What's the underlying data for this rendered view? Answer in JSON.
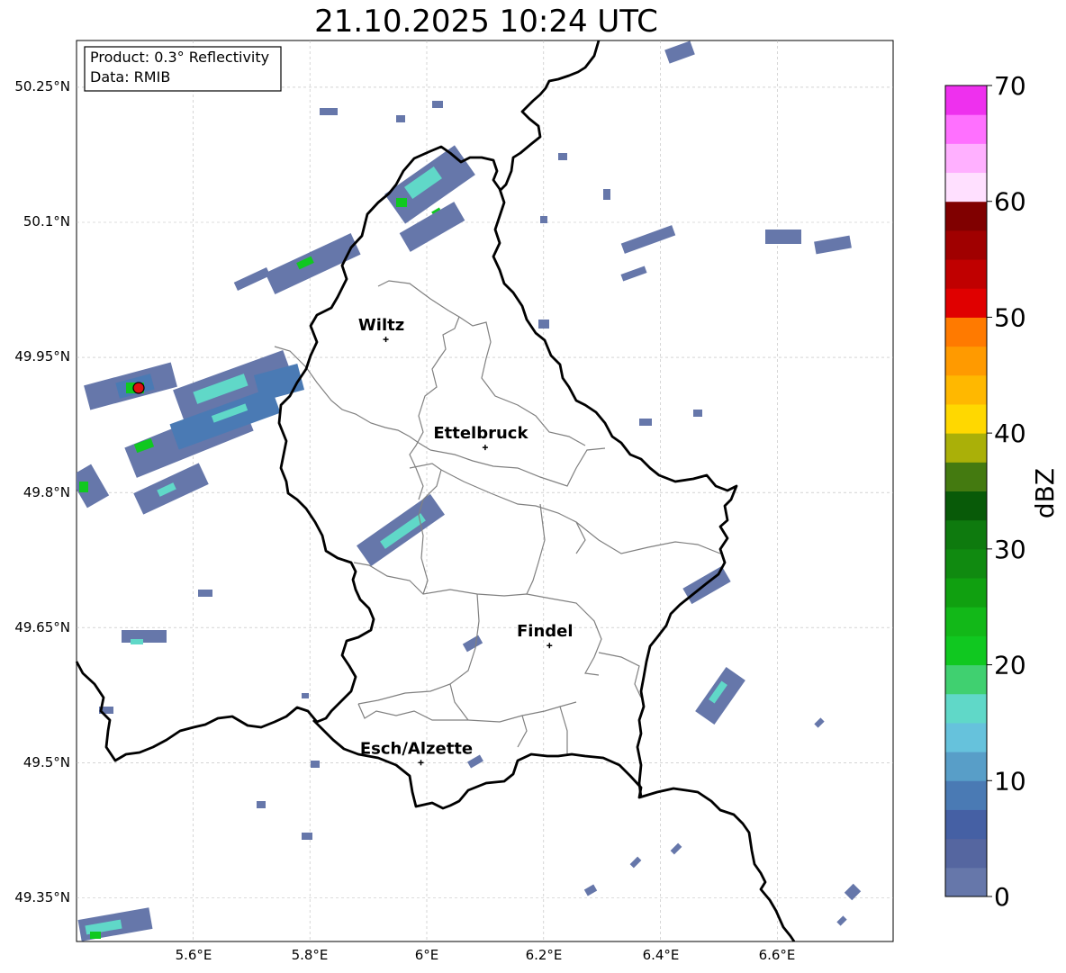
{
  "title": "21.10.2025 10:24 UTC",
  "info_box": {
    "product": "Product: 0.3° Reflectivity",
    "source": "Data: RMIB"
  },
  "lat_ticks": [
    "50.25°N",
    "50.1°N",
    "49.95°N",
    "49.8°N",
    "49.65°N",
    "49.5°N",
    "49.35°N"
  ],
  "lon_ticks": [
    "5.6°E",
    "5.8°E",
    "6°E",
    "6.2°E",
    "6.4°E",
    "6.6°E"
  ],
  "cities": [
    {
      "name": "Wiltz",
      "lat": 49.97,
      "lon": 5.93
    },
    {
      "name": "Ettelbruck",
      "lat": 49.85,
      "lon": 6.1
    },
    {
      "name": "Findel",
      "lat": 49.63,
      "lon": 6.21
    },
    {
      "name": "Esch/Alzette",
      "lat": 49.5,
      "lon": 5.99
    }
  ],
  "radar_site": {
    "lat": 49.915,
    "lon": 5.505
  },
  "colorbar": {
    "label": "dBZ",
    "ticks": [
      "0",
      "10",
      "20",
      "30",
      "40",
      "50",
      "60",
      "70"
    ],
    "colors": [
      "#6677aa",
      "#5566a0",
      "#4560a4",
      "#4a7ab4",
      "#589ec8",
      "#66c2dc",
      "#60d8c8",
      "#40d070",
      "#10c820",
      "#12b818",
      "#10a010",
      "#108a10",
      "#0e7a0e",
      "#085a08",
      "#447a10",
      "#aab008",
      "#ffd800",
      "#ffb800",
      "#ff9a00",
      "#ff7a00",
      "#e00000",
      "#c00000",
      "#a00000",
      "#800000",
      "#ffe0ff",
      "#ffb0ff",
      "#ff70ff",
      "#ee30ee"
    ]
  },
  "colors": {
    "echo_weak": "#6677aa",
    "echo_mid": "#4a7ab4",
    "echo_teal": "#60d8c8",
    "echo_green": "#10c820",
    "border": "#000000",
    "canton_border": "#808080",
    "grid": "#bbbbbb"
  }
}
